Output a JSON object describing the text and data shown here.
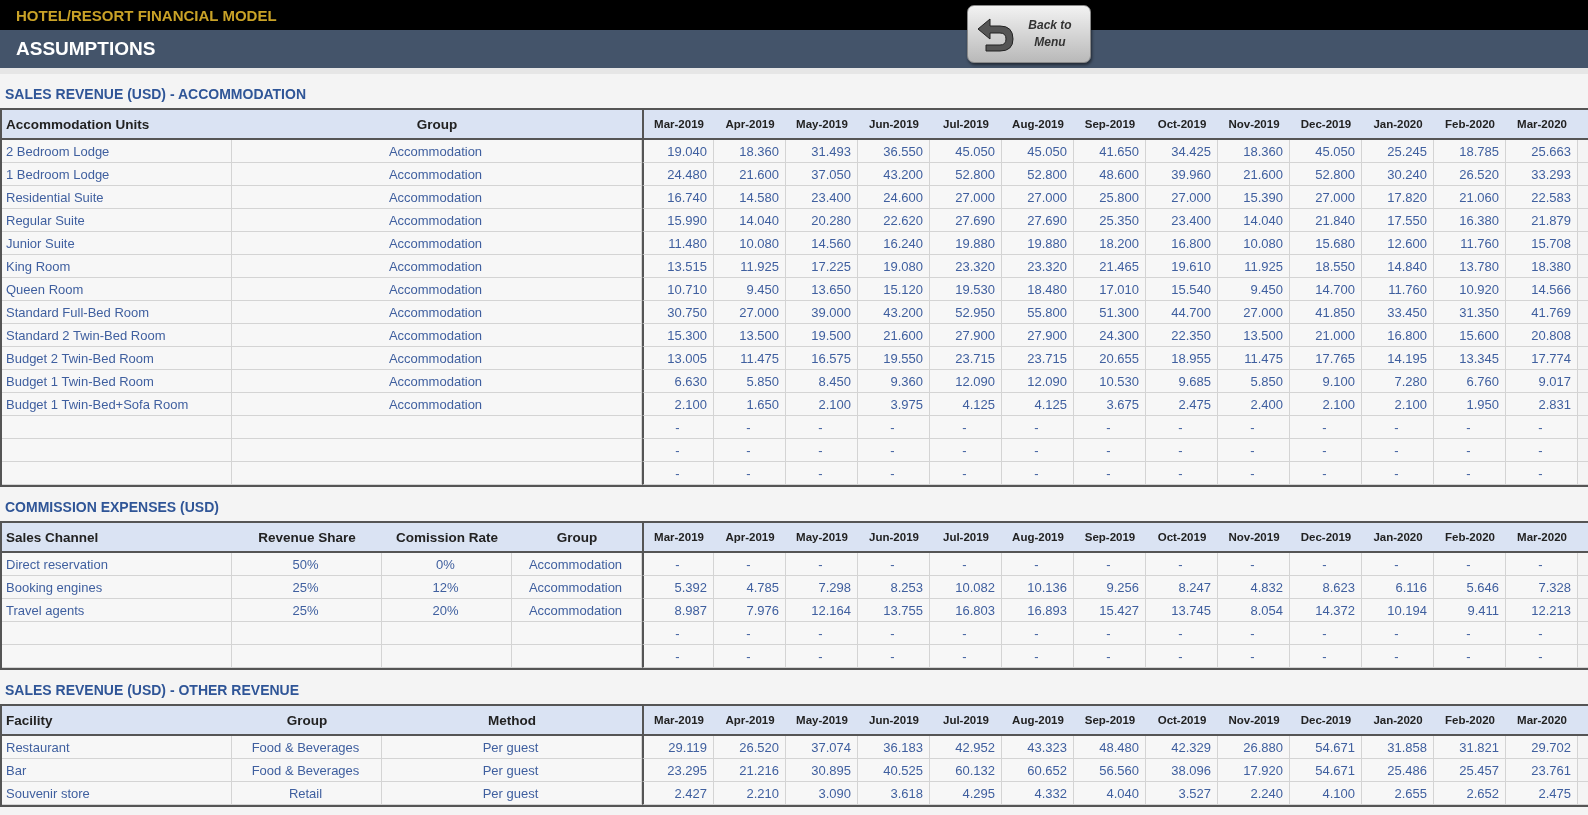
{
  "app_title": "HOTEL/RESORT FINANCIAL MODEL",
  "sheet_title": "ASSUMPTIONS",
  "back_button": {
    "label": "Back to Menu"
  },
  "sections": [
    {
      "title": "SALES REVENUE (USD) - ACCOMMODATION",
      "columns": [
        "Accommodation Units",
        "Group"
      ],
      "months": [
        "Mar-2019",
        "Apr-2019",
        "May-2019",
        "Jun-2019",
        "Jul-2019",
        "Aug-2019",
        "Sep-2019",
        "Oct-2019",
        "Nov-2019",
        "Dec-2019",
        "Jan-2020",
        "Feb-2020",
        "Mar-2020"
      ],
      "rows": [
        {
          "cells": [
            "2 Bedroom Lodge",
            "Accommodation"
          ],
          "values": [
            "19.040",
            "18.360",
            "31.493",
            "36.550",
            "45.050",
            "45.050",
            "41.650",
            "34.425",
            "18.360",
            "45.050",
            "25.245",
            "18.785",
            "25.663"
          ]
        },
        {
          "cells": [
            "1 Bedroom Lodge",
            "Accommodation"
          ],
          "values": [
            "24.480",
            "21.600",
            "37.050",
            "43.200",
            "52.800",
            "52.800",
            "48.600",
            "39.960",
            "21.600",
            "52.800",
            "30.240",
            "26.520",
            "33.293"
          ]
        },
        {
          "cells": [
            "Residential Suite",
            "Accommodation"
          ],
          "values": [
            "16.740",
            "14.580",
            "23.400",
            "24.600",
            "27.000",
            "27.000",
            "25.800",
            "27.000",
            "15.390",
            "27.000",
            "17.820",
            "21.060",
            "22.583"
          ]
        },
        {
          "cells": [
            "Regular Suite",
            "Accommodation"
          ],
          "values": [
            "15.990",
            "14.040",
            "20.280",
            "22.620",
            "27.690",
            "27.690",
            "25.350",
            "23.400",
            "14.040",
            "21.840",
            "17.550",
            "16.380",
            "21.879"
          ]
        },
        {
          "cells": [
            "Junior Suite",
            "Accommodation"
          ],
          "values": [
            "11.480",
            "10.080",
            "14.560",
            "16.240",
            "19.880",
            "19.880",
            "18.200",
            "16.800",
            "10.080",
            "15.680",
            "12.600",
            "11.760",
            "15.708"
          ]
        },
        {
          "cells": [
            "King Room",
            "Accommodation"
          ],
          "values": [
            "13.515",
            "11.925",
            "17.225",
            "19.080",
            "23.320",
            "23.320",
            "21.465",
            "19.610",
            "11.925",
            "18.550",
            "14.840",
            "13.780",
            "18.380"
          ]
        },
        {
          "cells": [
            "Queen Room",
            "Accommodation"
          ],
          "values": [
            "10.710",
            "9.450",
            "13.650",
            "15.120",
            "19.530",
            "18.480",
            "17.010",
            "15.540",
            "9.450",
            "14.700",
            "11.760",
            "10.920",
            "14.566"
          ]
        },
        {
          "cells": [
            "Standard Full-Bed Room",
            "Accommodation"
          ],
          "values": [
            "30.750",
            "27.000",
            "39.000",
            "43.200",
            "52.950",
            "55.800",
            "51.300",
            "44.700",
            "27.000",
            "41.850",
            "33.450",
            "31.350",
            "41.769"
          ]
        },
        {
          "cells": [
            "Standard 2 Twin-Bed Room",
            "Accommodation"
          ],
          "values": [
            "15.300",
            "13.500",
            "19.500",
            "21.600",
            "27.900",
            "27.900",
            "24.300",
            "22.350",
            "13.500",
            "21.000",
            "16.800",
            "15.600",
            "20.808"
          ]
        },
        {
          "cells": [
            "Budget 2 Twin-Bed Room",
            "Accommodation"
          ],
          "values": [
            "13.005",
            "11.475",
            "16.575",
            "19.550",
            "23.715",
            "23.715",
            "20.655",
            "18.955",
            "11.475",
            "17.765",
            "14.195",
            "13.345",
            "17.774"
          ]
        },
        {
          "cells": [
            "Budget 1 Twin-Bed Room",
            "Accommodation"
          ],
          "values": [
            "6.630",
            "5.850",
            "8.450",
            "9.360",
            "12.090",
            "12.090",
            "10.530",
            "9.685",
            "5.850",
            "9.100",
            "7.280",
            "6.760",
            "9.017"
          ]
        },
        {
          "cells": [
            "Budget 1 Twin-Bed+Sofa Room",
            "Accommodation"
          ],
          "values": [
            "2.100",
            "1.650",
            "2.100",
            "3.975",
            "4.125",
            "4.125",
            "3.675",
            "2.475",
            "2.400",
            "2.100",
            "2.100",
            "1.950",
            "2.831"
          ]
        },
        {
          "cells": [],
          "values": [
            "-",
            "-",
            "-",
            "-",
            "-",
            "-",
            "-",
            "-",
            "-",
            "-",
            "-",
            "-",
            "-"
          ]
        },
        {
          "cells": [],
          "values": [
            "-",
            "-",
            "-",
            "-",
            "-",
            "-",
            "-",
            "-",
            "-",
            "-",
            "-",
            "-",
            "-"
          ]
        },
        {
          "cells": [],
          "values": [
            "-",
            "-",
            "-",
            "-",
            "-",
            "-",
            "-",
            "-",
            "-",
            "-",
            "-",
            "-",
            "-"
          ]
        }
      ]
    },
    {
      "title": "COMMISSION EXPENSES (USD)",
      "columns": [
        "Sales Channel",
        "Revenue Share",
        "Comission Rate",
        "Group"
      ],
      "months": [
        "Mar-2019",
        "Apr-2019",
        "May-2019",
        "Jun-2019",
        "Jul-2019",
        "Aug-2019",
        "Sep-2019",
        "Oct-2019",
        "Nov-2019",
        "Dec-2019",
        "Jan-2020",
        "Feb-2020",
        "Mar-2020"
      ],
      "rows": [
        {
          "cells": [
            "Direct reservation",
            "50%",
            "0%",
            "Accommodation"
          ],
          "values": [
            "-",
            "-",
            "-",
            "-",
            "-",
            "-",
            "-",
            "-",
            "-",
            "-",
            "-",
            "-",
            "-"
          ]
        },
        {
          "cells": [
            "Booking engines",
            "25%",
            "12%",
            "Accommodation"
          ],
          "values": [
            "5.392",
            "4.785",
            "7.298",
            "8.253",
            "10.082",
            "10.136",
            "9.256",
            "8.247",
            "4.832",
            "8.623",
            "6.116",
            "5.646",
            "7.328"
          ]
        },
        {
          "cells": [
            "Travel agents",
            "25%",
            "20%",
            "Accommodation"
          ],
          "values": [
            "8.987",
            "7.976",
            "12.164",
            "13.755",
            "16.803",
            "16.893",
            "15.427",
            "13.745",
            "8.054",
            "14.372",
            "10.194",
            "9.411",
            "12.213"
          ]
        },
        {
          "cells": [],
          "values": [
            "-",
            "-",
            "-",
            "-",
            "-",
            "-",
            "-",
            "-",
            "-",
            "-",
            "-",
            "-",
            "-"
          ]
        },
        {
          "cells": [],
          "values": [
            "-",
            "-",
            "-",
            "-",
            "-",
            "-",
            "-",
            "-",
            "-",
            "-",
            "-",
            "-",
            "-"
          ]
        }
      ]
    },
    {
      "title": "SALES REVENUE (USD) - OTHER REVENUE",
      "columns": [
        "Facility",
        "Group",
        "Method"
      ],
      "months": [
        "Mar-2019",
        "Apr-2019",
        "May-2019",
        "Jun-2019",
        "Jul-2019",
        "Aug-2019",
        "Sep-2019",
        "Oct-2019",
        "Nov-2019",
        "Dec-2019",
        "Jan-2020",
        "Feb-2020",
        "Mar-2020"
      ],
      "rows": [
        {
          "cells": [
            "Restaurant",
            "Food & Beverages",
            "Per guest"
          ],
          "values": [
            "29.119",
            "26.520",
            "37.074",
            "36.183",
            "42.952",
            "43.323",
            "48.480",
            "42.329",
            "26.880",
            "54.671",
            "31.858",
            "31.821",
            "29.702"
          ]
        },
        {
          "cells": [
            "Bar",
            "Food & Beverages",
            "Per guest"
          ],
          "values": [
            "23.295",
            "21.216",
            "30.895",
            "40.525",
            "60.132",
            "60.652",
            "56.560",
            "38.096",
            "17.920",
            "54.671",
            "25.486",
            "25.457",
            "23.761"
          ]
        },
        {
          "cells": [
            "Souvenir store",
            "Retail",
            "Per guest"
          ],
          "values": [
            "2.427",
            "2.210",
            "3.090",
            "3.618",
            "4.295",
            "4.332",
            "4.040",
            "3.527",
            "2.240",
            "4.100",
            "2.655",
            "2.652",
            "2.475"
          ]
        }
      ]
    }
  ]
}
